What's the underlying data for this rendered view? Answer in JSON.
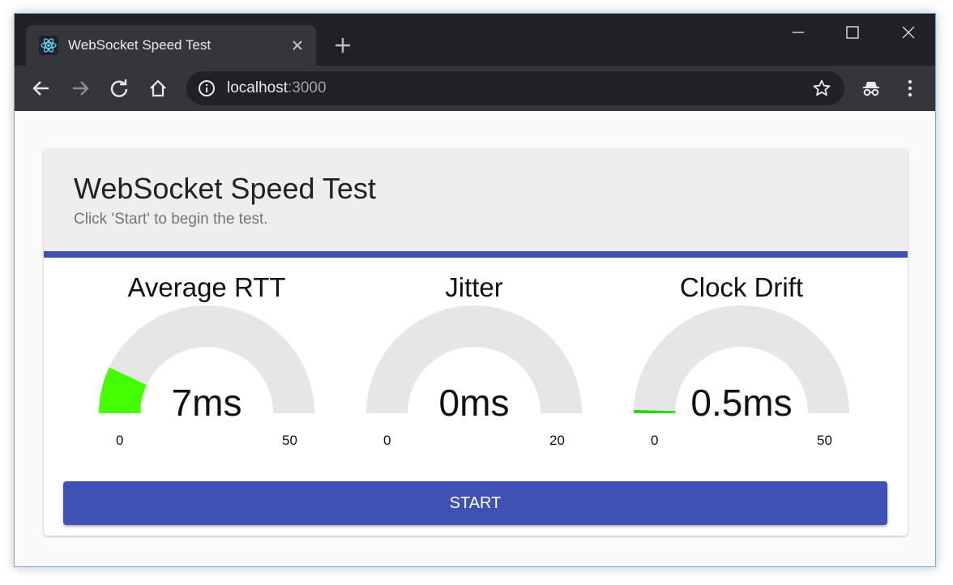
{
  "browser": {
    "tab_title": "WebSocket Speed Test",
    "url_host": "localhost",
    "url_port": ":3000"
  },
  "page": {
    "title": "WebSocket Speed Test",
    "subtitle": "Click 'Start' to begin the test.",
    "start_label": "START"
  },
  "gauges": [
    {
      "title": "Average RTT",
      "value_label": "7ms",
      "value": 7,
      "min": "0",
      "max": "50",
      "min_value": 0,
      "max_value": 50,
      "color": "#44ff00"
    },
    {
      "title": "Jitter",
      "value_label": "0ms",
      "value": 0,
      "min": "0",
      "max": "20",
      "min_value": 0,
      "max_value": 20,
      "color": "#44ff00"
    },
    {
      "title": "Clock Drift",
      "value_label": "0.5ms",
      "value": 0.5,
      "min": "0",
      "max": "50",
      "min_value": 0,
      "max_value": 50,
      "color": "#22dd00"
    }
  ],
  "colors": {
    "accent": "#3f51b5",
    "gauge_track": "#e6e6e6",
    "header_bg": "#eeeeee"
  }
}
